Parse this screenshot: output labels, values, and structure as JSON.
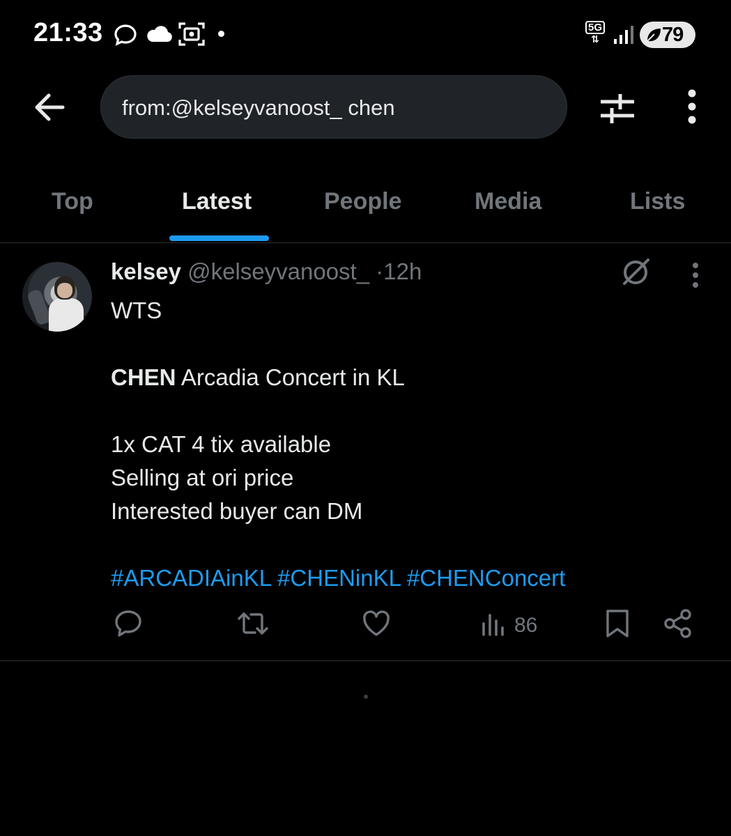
{
  "status_bar": {
    "time": "21:33",
    "network": "5G",
    "battery": "79",
    "icons": [
      "chat-bubble-icon",
      "cloud-icon",
      "screenshot-icon",
      "notification-dot-icon",
      "signal-icon",
      "battery-saver-leaf-icon"
    ]
  },
  "header": {
    "search_query": "from:@kelseyvanoost_ chen",
    "icons": [
      "back-arrow-icon",
      "filter-sliders-icon",
      "more-vertical-icon"
    ]
  },
  "tabs": [
    {
      "label": "Top",
      "active": false
    },
    {
      "label": "Latest",
      "active": true
    },
    {
      "label": "People",
      "active": false
    },
    {
      "label": "Media",
      "active": false
    },
    {
      "label": "Lists",
      "active": false
    }
  ],
  "tweet": {
    "display_name": "kelsey",
    "handle": "@kelseyvanoost_",
    "separator": "·",
    "time": "12h",
    "lines": {
      "l1": "WTS",
      "l2_bold": "CHEN",
      "l2_rest": " Arcadia Concert in KL",
      "l3": "1x CAT 4 tix available",
      "l4": "Selling at ori price",
      "l5": "Interested buyer can DM"
    },
    "hashtags": [
      "#ARCADIAinKL",
      "#CHENinKL",
      "#CHENConcert"
    ],
    "views": "86",
    "action_icons": [
      "reply-icon",
      "retweet-icon",
      "like-icon",
      "views-icon",
      "bookmark-icon",
      "share-icon"
    ],
    "accent_color": "#1d9bf0"
  }
}
